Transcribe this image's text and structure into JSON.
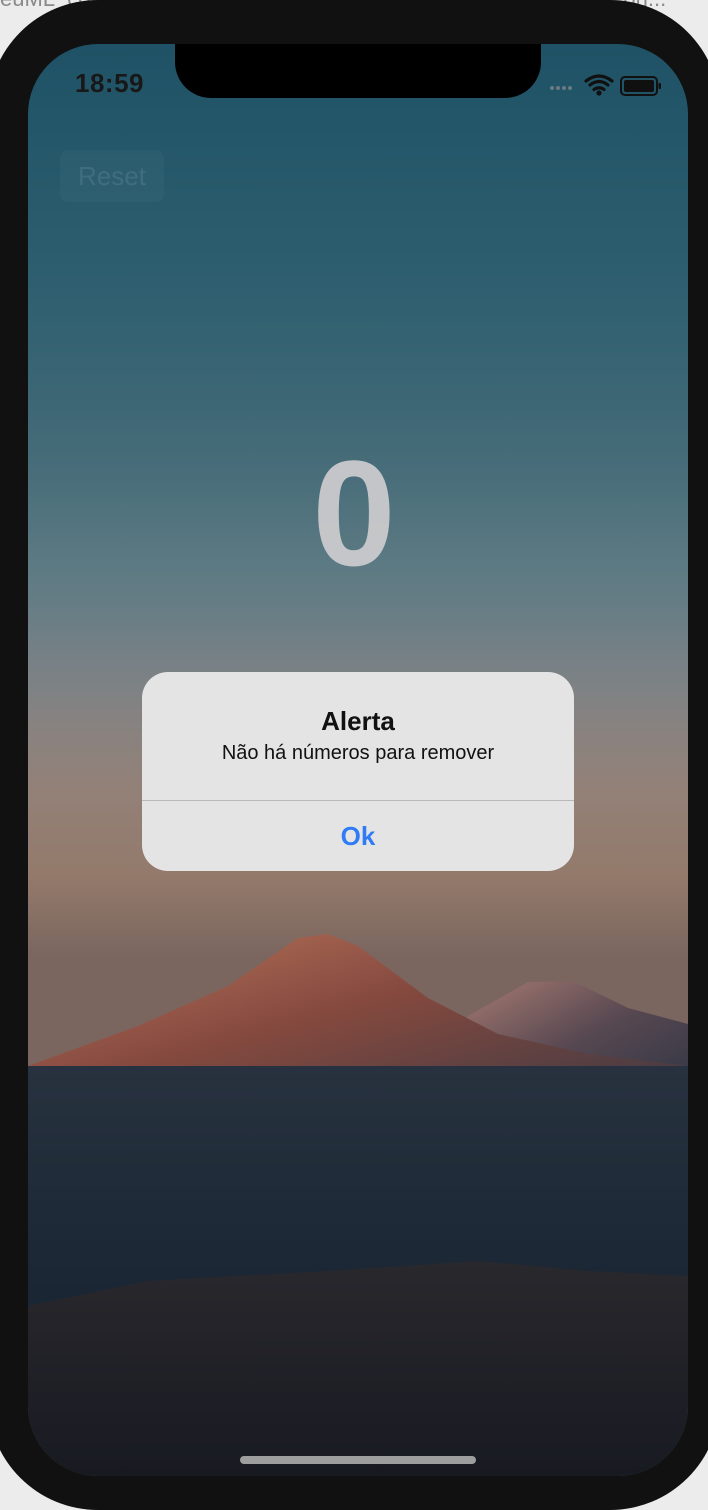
{
  "host": {
    "fragment_left": "euML_co",
    "fragment_mid": "· · · · · · · ··",
    "fragment_right": "· · · · · · · · Con..."
  },
  "status_bar": {
    "time": "18:59",
    "icons": [
      "signal-dots-icon",
      "wifi-icon",
      "battery-icon"
    ]
  },
  "app": {
    "reset_label": "Reset",
    "counter_value": "0"
  },
  "alert": {
    "title": "Alerta",
    "message": "Não há números para remover",
    "ok_label": "Ok",
    "ok_color": "#2f7cf6"
  },
  "colors": {
    "sky_top": "#21566b",
    "sky_horizon": "#99877d",
    "mountain_lit": "#b06a56",
    "foreground_dark": "#1b2a38"
  }
}
